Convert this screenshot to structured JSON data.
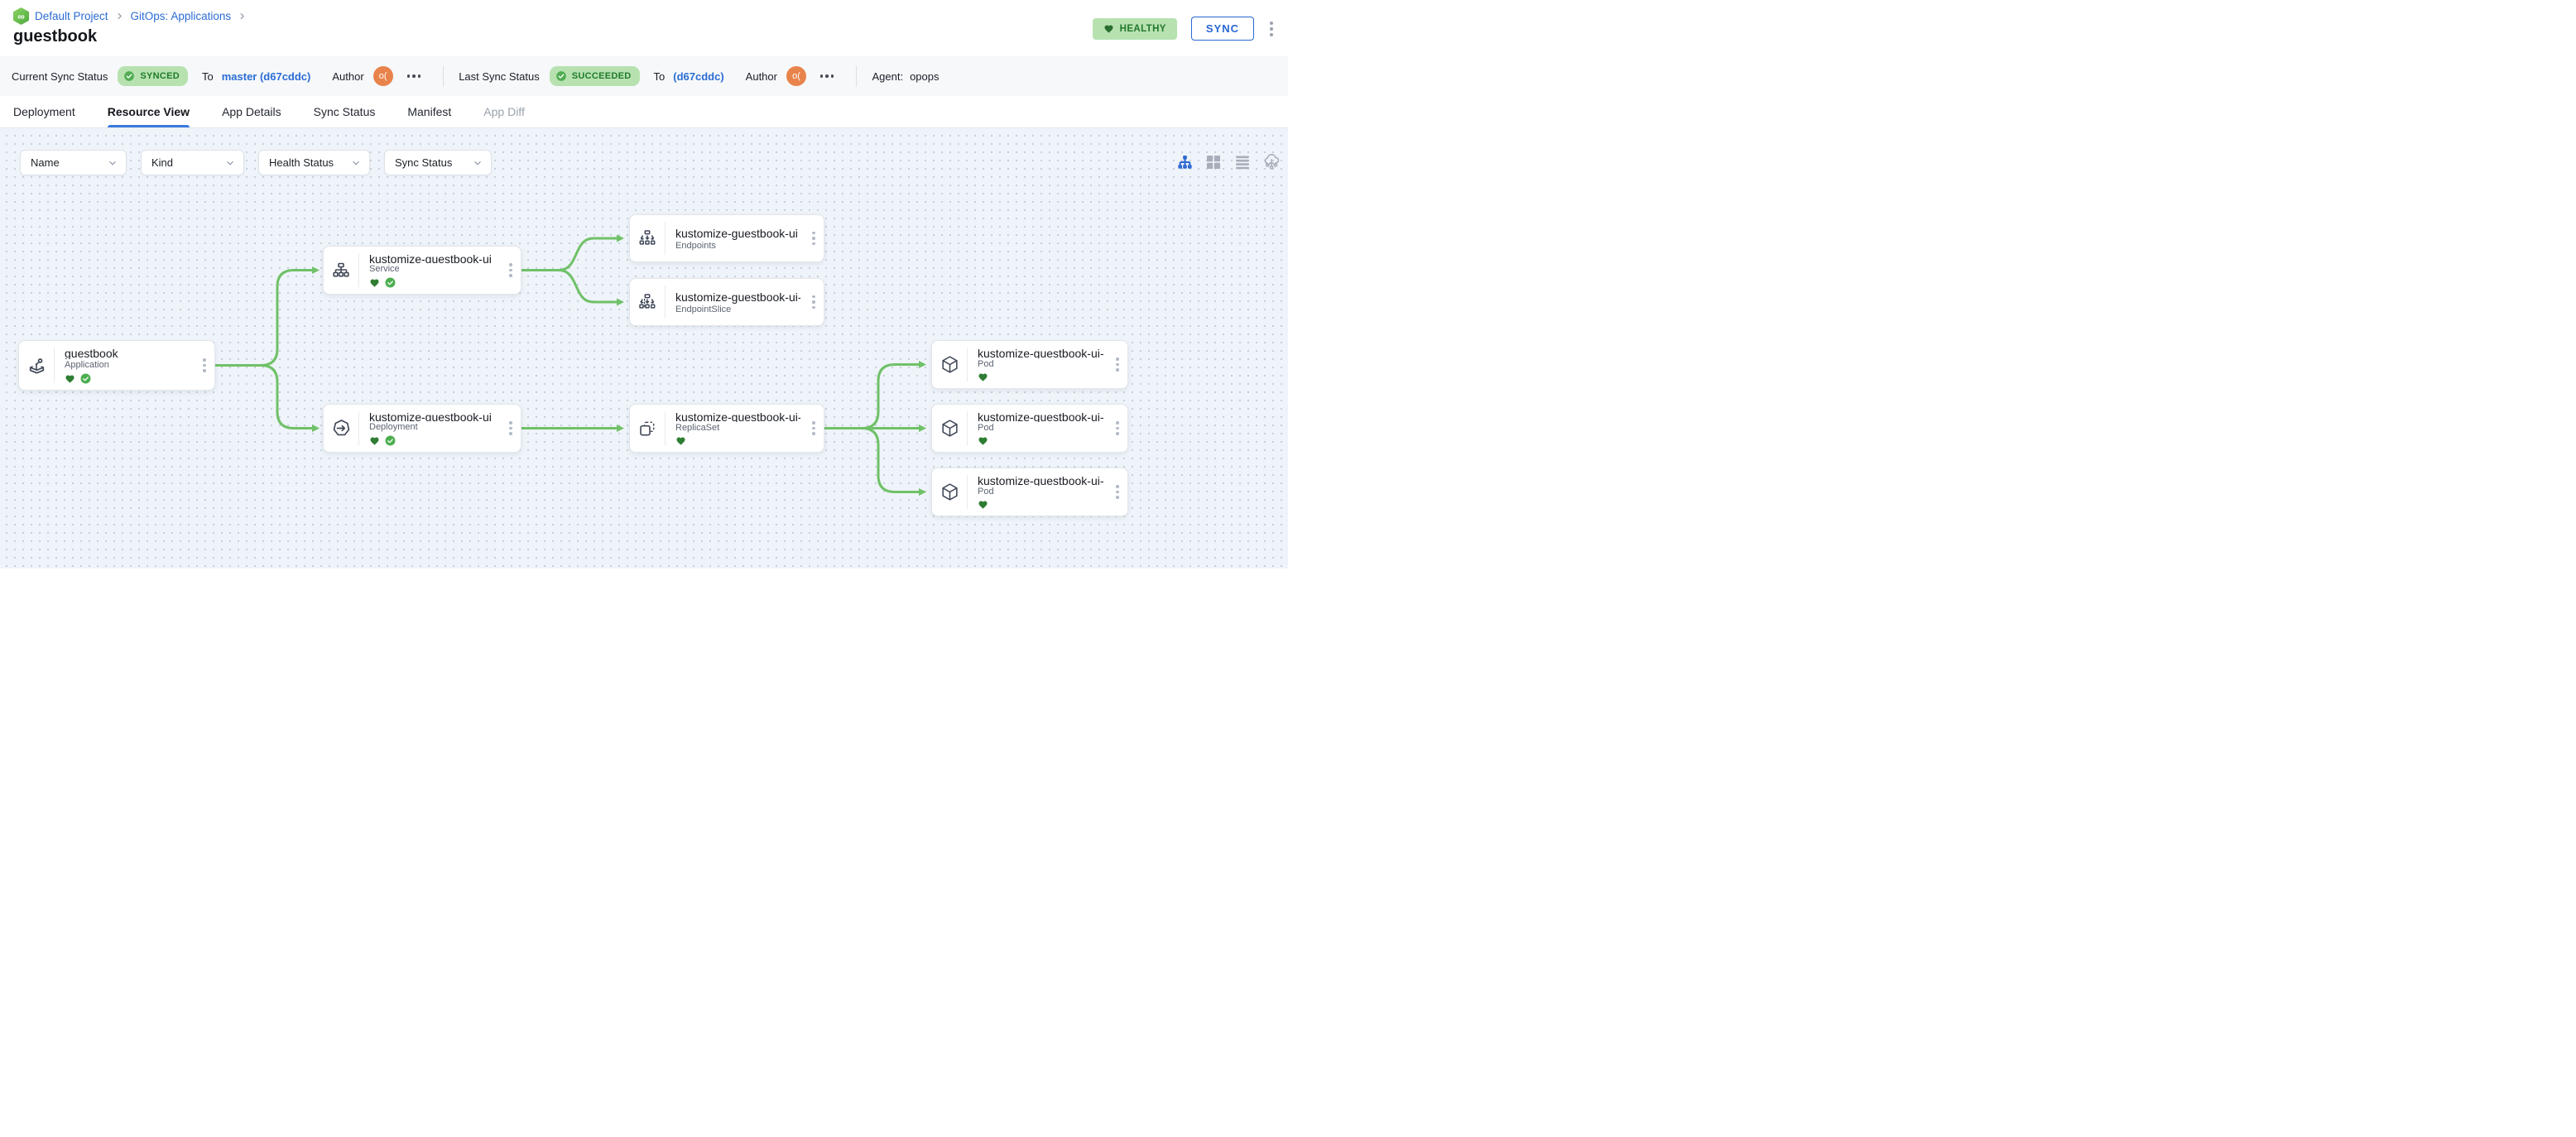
{
  "header": {
    "breadcrumb": {
      "project": "Default Project",
      "section": "GitOps: Applications"
    },
    "title": "guestbook",
    "health_badge": "HEALTHY",
    "sync_button": "SYNC"
  },
  "status_bar": {
    "current_label": "Current Sync Status",
    "current_badge": "SYNCED",
    "current_to_label": "To",
    "current_target": "master (d67cddc)",
    "current_author_label": "Author",
    "current_avatar": "o(",
    "last_label": "Last Sync Status",
    "last_badge": "SUCCEEDED",
    "last_to_label": "To",
    "last_target": "(d67cddc)",
    "last_author_label": "Author",
    "last_avatar": "o(",
    "agent_label": "Agent:",
    "agent_value": "opops"
  },
  "tabs": [
    {
      "label": "Deployment",
      "state": "normal"
    },
    {
      "label": "Resource View",
      "state": "active"
    },
    {
      "label": "App Details",
      "state": "normal"
    },
    {
      "label": "Sync Status",
      "state": "normal"
    },
    {
      "label": "Manifest",
      "state": "normal"
    },
    {
      "label": "App Diff",
      "state": "disabled"
    }
  ],
  "filters": {
    "name": "Name",
    "kind": "Kind",
    "health": "Health Status",
    "sync": "Sync Status"
  },
  "view_toggles": {
    "active": "tree-view",
    "options": [
      "tree-view",
      "grid-view",
      "list-view",
      "cluster-view"
    ]
  },
  "nodes": [
    {
      "title": "guestbook",
      "kind": "Application",
      "healthy": true,
      "synced": true
    },
    {
      "title": "kustomize-guestbook-ui",
      "kind": "Service",
      "healthy": true,
      "synced": true
    },
    {
      "title": "kustomize-guestbook-ui",
      "kind": "Endpoints"
    },
    {
      "title": "kustomize-guestbook-ui-...",
      "kind": "EndpointSlice"
    },
    {
      "title": "kustomize-guestbook-ui",
      "kind": "Deployment",
      "healthy": true,
      "synced": true
    },
    {
      "title": "kustomize-guestbook-ui-...",
      "kind": "ReplicaSet",
      "healthy": true
    },
    {
      "title": "kustomize-guestbook-ui-...",
      "kind": "Pod",
      "healthy": true
    },
    {
      "title": "kustomize-guestbook-ui-...",
      "kind": "Pod",
      "healthy": true
    },
    {
      "title": "kustomize-guestbook-ui-...",
      "kind": "Pod",
      "healthy": true
    }
  ],
  "colors": {
    "accent_blue": "#2b6cd4",
    "connector_green": "#70c168",
    "healthy_heart_green": "#2e7d32",
    "synced_check_green": "#4caf50",
    "badge_bg_green": "#b7e2b0",
    "canvas_bg": "#eef4f9"
  }
}
